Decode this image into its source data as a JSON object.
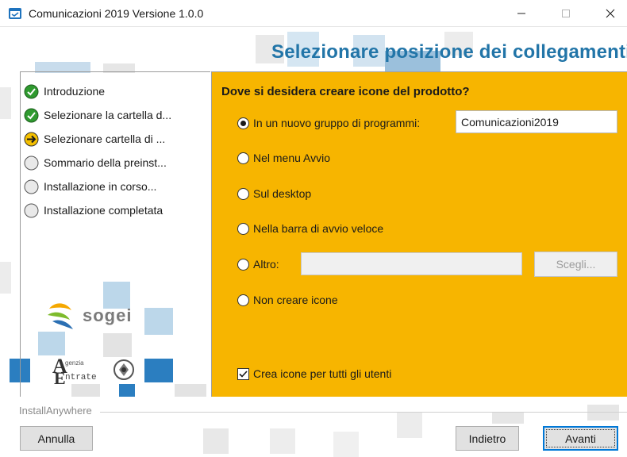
{
  "window": {
    "title": "Comunicazioni 2019 Versione 1.0.0",
    "app_icon": "installer-icon",
    "controls": [
      "minimize-icon",
      "maximize-icon",
      "close-icon"
    ]
  },
  "header": {
    "title": "Selezionare posizione dei collegamenti"
  },
  "steps": {
    "items": [
      {
        "label": "Introduzione",
        "icon": "check-done-icon",
        "state": "done"
      },
      {
        "label": "Selezionare la cartella d...",
        "icon": "check-done-icon",
        "state": "done"
      },
      {
        "label": "Selezionare cartella di ...",
        "icon": "arrow-current-icon",
        "state": "current"
      },
      {
        "label": "Sommario della preinst...",
        "icon": "circle-pending-icon",
        "state": "pending"
      },
      {
        "label": "Installazione in corso...",
        "icon": "circle-pending-icon",
        "state": "pending"
      },
      {
        "label": "Installazione completata",
        "icon": "circle-pending-icon",
        "state": "pending"
      }
    ]
  },
  "logos": {
    "sogei": "sogei",
    "entrate_line1": "genzia",
    "entrate_line2": "ntrate",
    "entrate_initial_a": "A",
    "entrate_initial_e": "E"
  },
  "main": {
    "question": "Dove si desidera creare icone del prodotto?",
    "options": [
      {
        "label": "In un nuovo gruppo di programmi:",
        "selected": true
      },
      {
        "label": "Nel menu Avvio",
        "selected": false
      },
      {
        "label": "Sul desktop",
        "selected": false
      },
      {
        "label": "Nella barra di avvio veloce",
        "selected": false
      },
      {
        "label": "Altro:",
        "selected": false
      },
      {
        "label": "Non creare icone",
        "selected": false
      }
    ],
    "group_value": "Comunicazioni2019",
    "altro_value": "",
    "scegli_label": "Scegli...",
    "all_users_label": "Crea icone per tutti gli utenti",
    "all_users_checked": true
  },
  "footer": {
    "vendor": "InstallAnywhere",
    "cancel_label": "Annulla",
    "back_label": "Indietro",
    "next_label": "Avanti"
  },
  "colors": {
    "panel_background": "#f7b500",
    "header_title": "#2275a8",
    "tile_blue": "#bcd7ea",
    "tile_dark_blue": "#2b7ec0",
    "tile_grey": "#e3e3e3",
    "done_green": "#2f9a2f",
    "current_yellow": "#f5c000"
  }
}
